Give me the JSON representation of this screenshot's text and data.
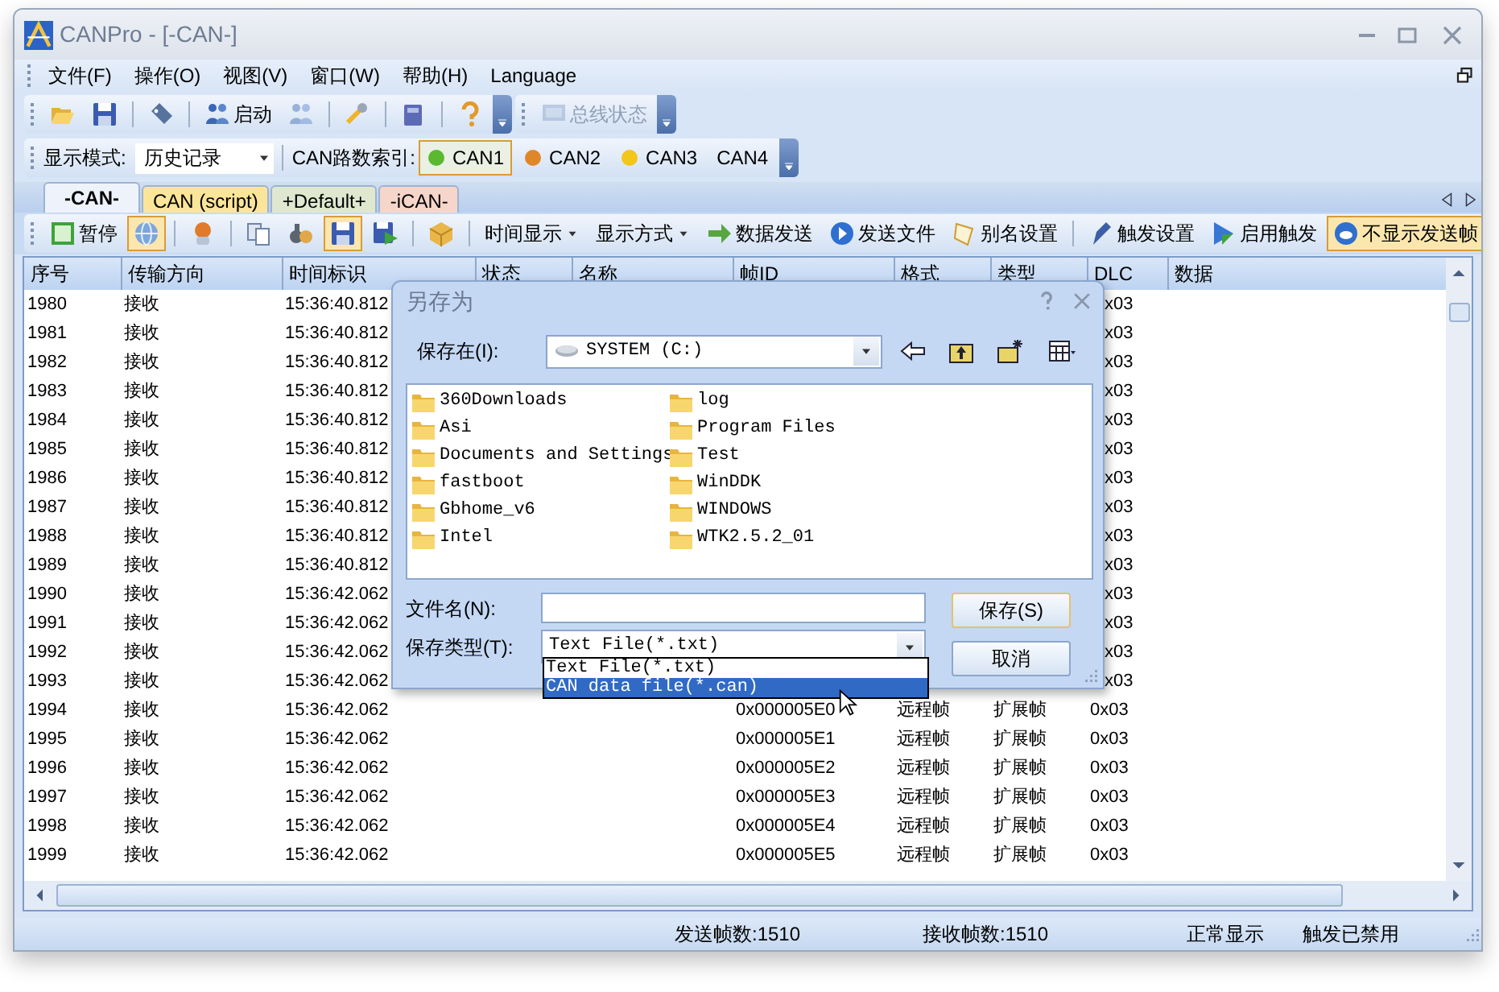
{
  "window": {
    "title": "CANPro - [-CAN-]"
  },
  "menu": [
    "文件(F)",
    "操作(O)",
    "视图(V)",
    "窗口(W)",
    "帮助(H)",
    "Language"
  ],
  "toolbar_main": {
    "groups": [
      [
        {
          "disabled": false
        },
        {
          "disabled": false
        }
      ],
      [
        {
          "disabled": false
        }
      ],
      [
        {
          "label": "启动",
          "disabled": false
        },
        {
          "disabled": true
        }
      ],
      [
        {
          "disabled": false
        }
      ],
      [
        {
          "disabled": false
        }
      ],
      [
        {
          "disabled": false
        }
      ]
    ],
    "bus_status": {
      "label": "总线状态",
      "disabled": true
    }
  },
  "toolbar_channels": {
    "mode_label": "显示模式:",
    "mode_value": "历史记录",
    "index_label": "CAN路数索引:",
    "channels": [
      {
        "label": "CAN1",
        "selected": true,
        "color": "#5cb82e"
      },
      {
        "label": "CAN2",
        "selected": false,
        "color": "#e0862a"
      },
      {
        "label": "CAN3",
        "selected": false,
        "color": "#f2c61b"
      },
      {
        "label": "CAN4",
        "selected": false
      }
    ]
  },
  "tabs": [
    {
      "label": "-CAN-",
      "selected": true,
      "color": "#eef3fb"
    },
    {
      "label": "CAN (script)",
      "selected": false,
      "color": "#fbe598"
    },
    {
      "label": "+Default+",
      "selected": false,
      "color": "#dfe8cf"
    },
    {
      "label": "-iCAN-",
      "selected": false,
      "color": "#f6d6ca"
    }
  ],
  "toolbar_view": {
    "groups": [
      [
        {
          "label": "暂停",
          "pressed": false
        },
        {
          "pressed": true
        }
      ],
      [
        {
          "pressed": false
        }
      ],
      [
        {
          "pressed": false
        },
        {
          "pressed": false
        },
        {
          "pressed": true
        },
        {
          "pressed": false
        }
      ],
      [
        {
          "pressed": false
        }
      ],
      [
        {
          "label": "时间显示",
          "dropdown": true,
          "pressed": false
        },
        {
          "label": "显示方式",
          "dropdown": true,
          "pressed": false
        },
        {
          "label": "数据发送",
          "pressed": false
        },
        {
          "label": "发送文件",
          "pressed": false
        },
        {
          "label": "别名设置",
          "pressed": false
        }
      ],
      [
        {
          "label": "触发设置",
          "pressed": false
        },
        {
          "label": "启用触发",
          "pressed": false
        },
        {
          "label": "不显示发送帧",
          "pressed": true
        }
      ]
    ]
  },
  "table": {
    "columns": [
      "序号",
      "传输方向",
      "时间标识",
      "状态",
      "名称",
      "帧ID",
      "格式",
      "类型",
      "DLC",
      "数据"
    ],
    "rows": [
      {
        "seq": "1980",
        "direction": "接收",
        "time": "15:36:40.812",
        "dlc": "x03"
      },
      {
        "seq": "1981",
        "direction": "接收",
        "time": "15:36:40.812",
        "dlc": "x03"
      },
      {
        "seq": "1982",
        "direction": "接收",
        "time": "15:36:40.812",
        "dlc": "x03"
      },
      {
        "seq": "1983",
        "direction": "接收",
        "time": "15:36:40.812",
        "dlc": "x03"
      },
      {
        "seq": "1984",
        "direction": "接收",
        "time": "15:36:40.812",
        "dlc": "x03"
      },
      {
        "seq": "1985",
        "direction": "接收",
        "time": "15:36:40.812",
        "dlc": "x03"
      },
      {
        "seq": "1986",
        "direction": "接收",
        "time": "15:36:40.812",
        "dlc": "x03"
      },
      {
        "seq": "1987",
        "direction": "接收",
        "time": "15:36:40.812",
        "dlc": "x03"
      },
      {
        "seq": "1988",
        "direction": "接收",
        "time": "15:36:40.812",
        "dlc": "x03"
      },
      {
        "seq": "1989",
        "direction": "接收",
        "time": "15:36:40.812",
        "dlc": "x03"
      },
      {
        "seq": "1990",
        "direction": "接收",
        "time": "15:36:42.062",
        "dlc": "x03"
      },
      {
        "seq": "1991",
        "direction": "接收",
        "time": "15:36:42.062",
        "dlc": "x03"
      },
      {
        "seq": "1992",
        "direction": "接收",
        "time": "15:36:42.062",
        "dlc": "x03"
      },
      {
        "seq": "1993",
        "direction": "接收",
        "time": "15:36:42.062",
        "dlc": "x03"
      },
      {
        "seq": "1994",
        "direction": "接收",
        "time": "15:36:42.062",
        "frame_id": "0x000005E0",
        "format": "远程帧",
        "type": "扩展帧",
        "dlc": "0x03"
      },
      {
        "seq": "1995",
        "direction": "接收",
        "time": "15:36:42.062",
        "frame_id": "0x000005E1",
        "format": "远程帧",
        "type": "扩展帧",
        "dlc": "0x03"
      },
      {
        "seq": "1996",
        "direction": "接收",
        "time": "15:36:42.062",
        "frame_id": "0x000005E2",
        "format": "远程帧",
        "type": "扩展帧",
        "dlc": "0x03"
      },
      {
        "seq": "1997",
        "direction": "接收",
        "time": "15:36:42.062",
        "frame_id": "0x000005E3",
        "format": "远程帧",
        "type": "扩展帧",
        "dlc": "0x03"
      },
      {
        "seq": "1998",
        "direction": "接收",
        "time": "15:36:42.062",
        "frame_id": "0x000005E4",
        "format": "远程帧",
        "type": "扩展帧",
        "dlc": "0x03"
      },
      {
        "seq": "1999",
        "direction": "接收",
        "time": "15:36:42.062",
        "frame_id": "0x000005E5",
        "format": "远程帧",
        "type": "扩展帧",
        "dlc": "0x03"
      }
    ]
  },
  "status_bar": [
    "发送帧数:1510",
    "接收帧数:1510",
    "正常显示",
    "触发已禁用"
  ],
  "dialog": {
    "title": "另存为",
    "look_in_label": "保存在(I):",
    "look_in": "SYSTEM (C:)",
    "folders": [
      "360Downloads",
      "Asi",
      "Documents and Settings",
      "fastboot",
      "Gbhome_v6",
      "Intel",
      "log",
      "Program Files",
      "Test",
      "WinDDK",
      "WINDOWS",
      "WTK2.5.2_01"
    ],
    "filename_label": "文件名(N):",
    "filetype_label": "保存类型(T):",
    "filetype": "Text File(*.txt)",
    "save": "保存(S)",
    "cancel": "取消",
    "filetype_options": [
      {
        "label": "Text File(*.txt)",
        "selected": false
      },
      {
        "label": "CAN data file(*.can)",
        "selected": true
      }
    ]
  }
}
